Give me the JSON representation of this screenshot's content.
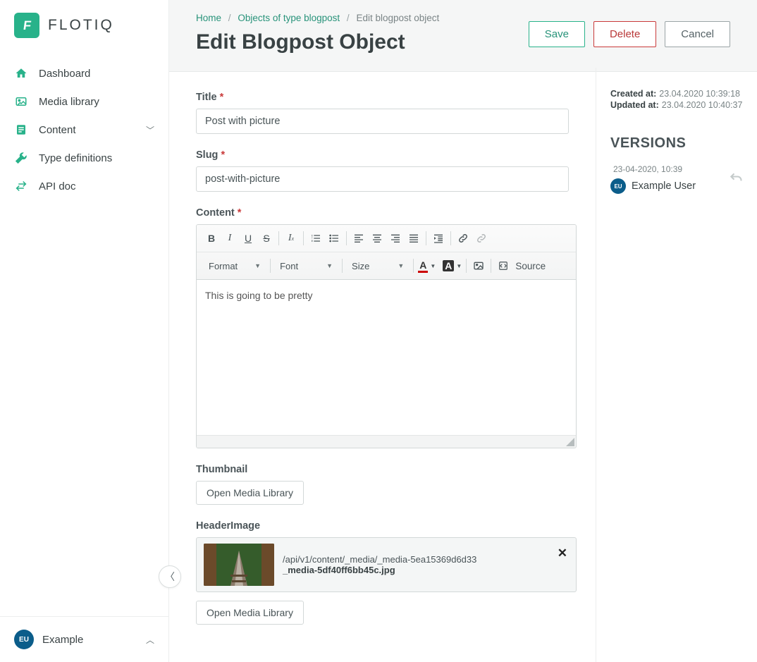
{
  "brand": {
    "name": "FLOTIQ",
    "icon_letter": "F"
  },
  "nav": {
    "dashboard": "Dashboard",
    "media": "Media library",
    "content": "Content",
    "types": "Type definitions",
    "api": "API doc"
  },
  "user": {
    "initials": "EU",
    "name": "Example"
  },
  "breadcrumb": {
    "home": "Home",
    "mid": "Objects of type blogpost",
    "current": "Edit blogpost object"
  },
  "page_title": "Edit Blogpost Object",
  "actions": {
    "save": "Save",
    "delete": "Delete",
    "cancel": "Cancel"
  },
  "fields": {
    "title_label": "Title",
    "title_value": "Post with picture",
    "slug_label": "Slug",
    "slug_value": "post-with-picture",
    "content_label": "Content",
    "content_value": "This is going to be pretty",
    "thumbnail_label": "Thumbnail",
    "thumbnail_button": "Open Media Library",
    "header_label": "HeaderImage",
    "header_button": "Open Media Library",
    "header_path": "/api/v1/content/_media/_media-5ea15369d6d33",
    "header_file": "_media-5df40ff6bb45c.jpg"
  },
  "editor": {
    "format": "Format",
    "font": "Font",
    "size": "Size",
    "source": "Source"
  },
  "meta": {
    "created_label": "Created at:",
    "created_value": "23.04.2020 10:39:18",
    "updated_label": "Updated at:",
    "updated_value": "23.04.2020 10:40:37"
  },
  "versions": {
    "title": "VERSIONS",
    "items": [
      {
        "date": "23-04-2020, 10:39",
        "initials": "EU",
        "user": "Example User"
      }
    ]
  }
}
